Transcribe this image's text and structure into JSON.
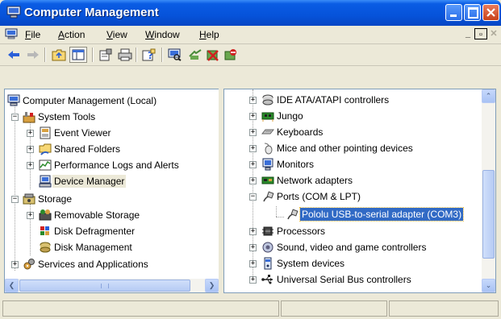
{
  "window": {
    "title": "Computer Management"
  },
  "menubar": {
    "items": [
      {
        "underline": "F",
        "rest": "ile"
      },
      {
        "underline": "A",
        "rest": "ction"
      },
      {
        "underline": "V",
        "rest": "iew"
      },
      {
        "underline": "W",
        "rest": "indow"
      },
      {
        "underline": "H",
        "rest": "elp"
      }
    ]
  },
  "toolbar": {
    "icons": [
      "back-arrow-icon",
      "forward-arrow-icon",
      "up-folder-icon",
      "show-hide-console-tree-icon",
      "properties-icon",
      "print-icon",
      "help-icon",
      "scan-hardware-icon",
      "update-driver-icon",
      "uninstall-icon",
      "disable-device-icon"
    ]
  },
  "tree": {
    "root": "Computer Management (Local)",
    "system_tools": "System Tools",
    "event_viewer": "Event Viewer",
    "shared_folders": "Shared Folders",
    "performance_logs": "Performance Logs and Alerts",
    "device_manager": "Device Manager",
    "storage": "Storage",
    "removable_storage": "Removable Storage",
    "disk_defragmenter": "Disk Defragmenter",
    "disk_management": "Disk Management",
    "services_apps": "Services and Applications"
  },
  "devices": {
    "ide": "IDE ATA/ATAPI controllers",
    "jungo": "Jungo",
    "keyboards": "Keyboards",
    "mice": "Mice and other pointing devices",
    "monitors": "Monitors",
    "network": "Network adapters",
    "ports": "Ports (COM & LPT)",
    "pololu": "Pololu USB-to-serial adapter (COM3)",
    "processors": "Processors",
    "sound": "Sound, video and game controllers",
    "system_devices": "System devices",
    "usb": "Universal Serial Bus controllers"
  },
  "colors": {
    "titlebar": "#0653da",
    "selection": "#316ac5",
    "window_bg": "#ece9d8"
  }
}
